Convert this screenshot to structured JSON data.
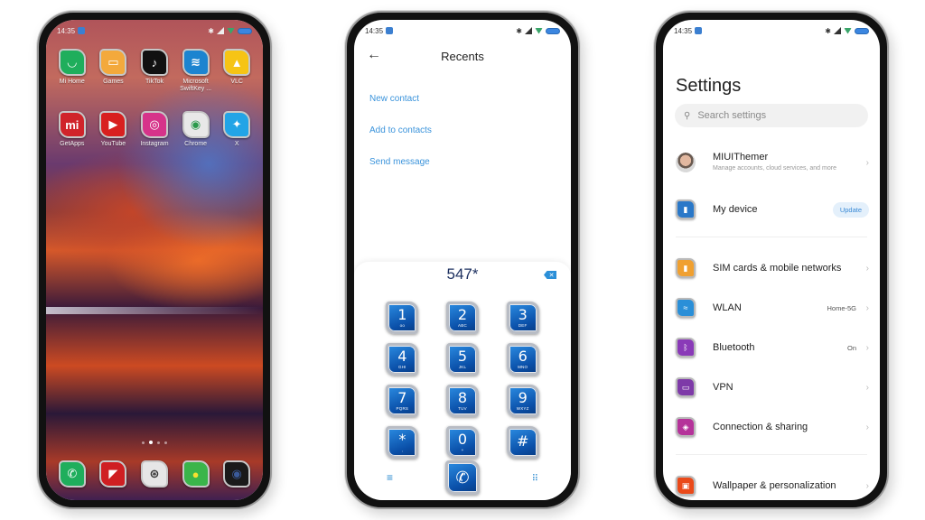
{
  "status_bar": {
    "time": "14:35"
  },
  "home": {
    "apps": [
      {
        "label": "Mi Home",
        "icon": "mi-home-icon",
        "glyph": "◡",
        "color": "#1fae5c"
      },
      {
        "label": "Games",
        "icon": "games-icon",
        "glyph": "▭",
        "color": "#f3a93c"
      },
      {
        "label": "TikTok",
        "icon": "tiktok-icon",
        "glyph": "♪",
        "color": "#111111"
      },
      {
        "label": "Microsoft SwiftKey ...",
        "icon": "swiftkey-icon",
        "glyph": "≋",
        "color": "#1c84d0"
      },
      {
        "label": "VLC",
        "icon": "vlc-icon",
        "glyph": "▲",
        "color": "#f6c415"
      },
      {
        "label": "GetApps",
        "icon": "getapps-icon",
        "glyph": "mi",
        "color": "#d0242a"
      },
      {
        "label": "YouTube",
        "icon": "youtube-icon",
        "glyph": "▶",
        "color": "#d8201f"
      },
      {
        "label": "Instagram",
        "icon": "instagram-icon",
        "glyph": "◎",
        "color": "#d6338a"
      },
      {
        "label": "Chrome",
        "icon": "chrome-icon",
        "glyph": "◉",
        "color": "#e8e8e8"
      },
      {
        "label": "X",
        "icon": "twitter-icon",
        "glyph": "✦",
        "color": "#22a4e6"
      }
    ],
    "dock": [
      {
        "icon": "phone-icon",
        "glyph": "✆",
        "color": "#1fae5c"
      },
      {
        "icon": "messages-icon",
        "glyph": "◤",
        "color": "#cf1f22"
      },
      {
        "icon": "settings-icon",
        "glyph": "⊛",
        "color": "#e6e6e6"
      },
      {
        "icon": "gallery-icon",
        "glyph": "●",
        "color": "#3ab54a"
      },
      {
        "icon": "camera-icon",
        "glyph": "◉",
        "color": "#1a1a1a"
      }
    ],
    "page_dots": 4,
    "active_page": 1
  },
  "dialer": {
    "title": "Recents",
    "links": [
      "New contact",
      "Add to contacts",
      "Send message"
    ],
    "number": "547*",
    "keys": [
      {
        "digit": "1",
        "letters": "ᴏᴏ"
      },
      {
        "digit": "2",
        "letters": "ABC"
      },
      {
        "digit": "3",
        "letters": "DEF"
      },
      {
        "digit": "4",
        "letters": "GHI"
      },
      {
        "digit": "5",
        "letters": "JKL"
      },
      {
        "digit": "6",
        "letters": "MNO"
      },
      {
        "digit": "7",
        "letters": "PQRS"
      },
      {
        "digit": "8",
        "letters": "TUV"
      },
      {
        "digit": "9",
        "letters": "WXYZ"
      },
      {
        "digit": "*",
        "letters": ","
      },
      {
        "digit": "0",
        "letters": "+"
      },
      {
        "digit": "#",
        "letters": ""
      }
    ]
  },
  "settings": {
    "title": "Settings",
    "search_placeholder": "Search settings",
    "account": {
      "name": "MIUIThemer",
      "subtitle": "Manage accounts, cloud services, and more"
    },
    "my_device": {
      "label": "My device",
      "badge": "Update"
    },
    "items": [
      {
        "label": "SIM cards & mobile networks",
        "value": "",
        "icon": "sim-card-icon",
        "glyph": "▮",
        "color": "#f0a030"
      },
      {
        "label": "WLAN",
        "value": "Home-5G",
        "icon": "wifi-icon",
        "glyph": "≈",
        "color": "#2a8fd8"
      },
      {
        "label": "Bluetooth",
        "value": "On",
        "icon": "bluetooth-icon",
        "glyph": "ᛒ",
        "color": "#8a3ab8"
      },
      {
        "label": "VPN",
        "value": "",
        "icon": "vpn-icon",
        "glyph": "▭",
        "color": "#7e3aa8"
      },
      {
        "label": "Connection & sharing",
        "value": "",
        "icon": "connection-sharing-icon",
        "glyph": "◈",
        "color": "#b5339a"
      }
    ],
    "bottom_item": {
      "label": "Wallpaper & personalization",
      "icon": "wallpaper-icon",
      "glyph": "▣",
      "color": "#ea4a1a"
    }
  }
}
